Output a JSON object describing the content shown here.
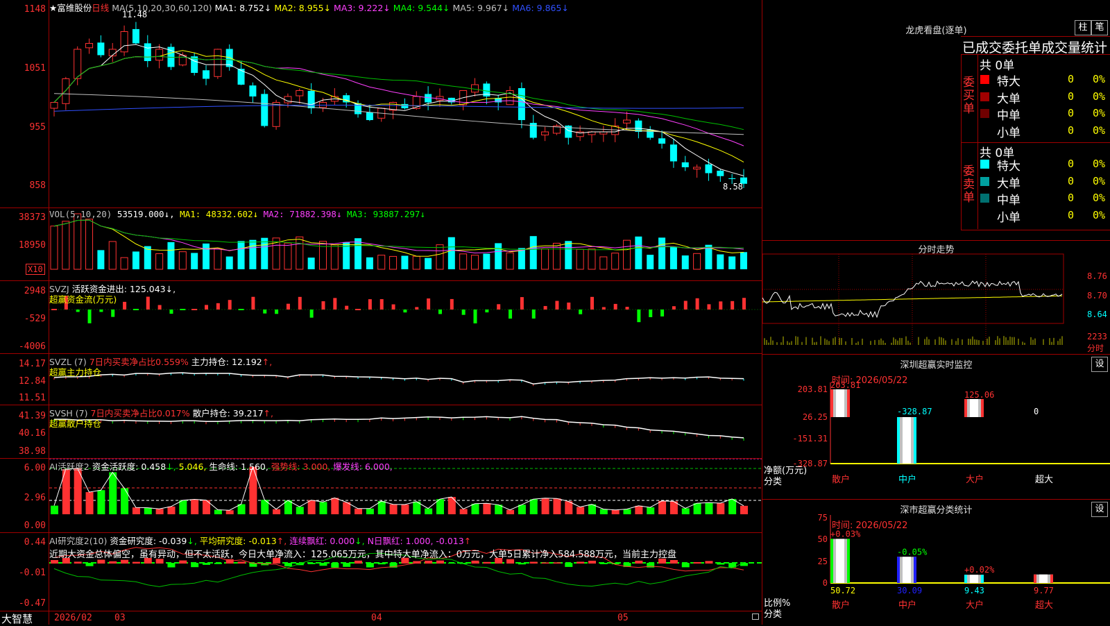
{
  "kline": {
    "stock": "★富维股份",
    "period": "日线",
    "ma_label": "MA(5,10,20,30,60,120)",
    "ma": [
      {
        "label": "MA1:",
        "value": "8.752",
        "arrow": "↓",
        "color": "#ffffff"
      },
      {
        "label": "MA2:",
        "value": "8.955",
        "arrow": "↓",
        "color": "#ffff00"
      },
      {
        "label": "MA3:",
        "value": "9.222",
        "arrow": "↓",
        "color": "#ff40ff"
      },
      {
        "label": "MA4:",
        "value": "9.544",
        "arrow": "↓",
        "color": "#00ff00"
      },
      {
        "label": "MA5:",
        "value": "9.967",
        "arrow": "↓",
        "color": "#c0c0c0"
      },
      {
        "label": "MA6:",
        "value": "9.865",
        "arrow": "↓",
        "color": "#3050ff"
      }
    ],
    "y_labels": [
      "1148",
      "1051",
      "955",
      "858"
    ],
    "high_mark": "11.48",
    "low_mark": "8.58"
  },
  "vol": {
    "title": "VOL(5,10,20)",
    "value": "53519.000",
    "ma": [
      {
        "label": "MA1:",
        "value": "48332.602",
        "arrow": "↓",
        "color": "#ffff00"
      },
      {
        "label": "MA2:",
        "value": "71882.398",
        "arrow": "↓",
        "color": "#ff40ff"
      },
      {
        "label": "MA3:",
        "value": "93887.297",
        "arrow": "↓",
        "color": "#00ff00"
      }
    ],
    "y_labels": [
      "38373",
      "18950"
    ],
    "unit": "X10"
  },
  "svzj": {
    "title": "SVZJ",
    "label": "活跃资金进出:",
    "value": "125.043",
    "arrow": "↓,",
    "sub": "超赢资金流(万元)",
    "y_labels": [
      "2948",
      "-529",
      "-4006"
    ]
  },
  "svzl": {
    "title": "SVZL (7)",
    "text1": "7日内买卖净占比0.559%",
    "text2": "主力持仓:",
    "value": "12.192",
    "arrow": "↑,",
    "sub": "超赢主力持仓",
    "y_labels": [
      "14.17",
      "12.84",
      "11.51"
    ]
  },
  "svsh": {
    "title": "SVSH (7)",
    "text1": "7日内买卖净占比0.017%",
    "text2": "散户持仓:",
    "value": "39.217",
    "arrow": "↑,",
    "sub": "超赢散户持仓",
    "y_labels": [
      "41.39",
      "40.16",
      "38.98"
    ]
  },
  "ai1": {
    "title": "AI活跃度2",
    "label": "资金活跃度:",
    "value1": "0.458",
    "value2": "5.046",
    "life_label": "生命线:",
    "life_value": "1.560",
    "strong": "强势线: 3.000,",
    "burst": "爆发线: 6.000,",
    "y_labels": [
      "6.00",
      "2.96",
      "0.00"
    ]
  },
  "ai2": {
    "title": "AI研究度2(10)",
    "label": "资金研究度:",
    "value": "-0.039",
    "avg": "平均研究度: -0.013",
    "lianxu": "连续飘红: 0.000",
    "nday": "N日飘红: 1.000, -0.013",
    "commentary": "近期大资金总体偏空，虽有异动，但不太活跃，今日大单净流入：125.065万元，其中特大单净流入：0万元，大单5日累计净入584.588万元，当前主力控盘",
    "y_labels": [
      "0.44",
      "-0.01",
      "-0.47"
    ]
  },
  "xaxis": {
    "brand": "大智慧",
    "labels": [
      "2026/02",
      "03",
      "04",
      "05"
    ]
  },
  "dragon": {
    "title": "龙虎看盘(逐单)",
    "btn1": "柱",
    "btn2": "笔",
    "header": "已成交委托单成交量统计",
    "buy_label": "委买单",
    "sell_label": "委卖单",
    "buy_total": "共 0单",
    "sell_total": "共 0单",
    "buy_rows": [
      {
        "name": "特大",
        "count": "0",
        "pct": "0%",
        "color": "#ff0000"
      },
      {
        "name": "大单",
        "count": "0",
        "pct": "0%",
        "color": "#a00000"
      },
      {
        "name": "中单",
        "count": "0",
        "pct": "0%",
        "color": "#700000"
      },
      {
        "name": "小单",
        "count": "0",
        "pct": "0%",
        "color": ""
      }
    ],
    "sell_rows": [
      {
        "name": "特大",
        "count": "0",
        "pct": "0%",
        "color": "#00ffff"
      },
      {
        "name": "大单",
        "count": "0",
        "pct": "0%",
        "color": "#00a0a0"
      },
      {
        "name": "中单",
        "count": "0",
        "pct": "0%",
        "color": "#007070"
      },
      {
        "name": "小单",
        "count": "0",
        "pct": "0%",
        "color": ""
      }
    ]
  },
  "intraday": {
    "title": "分时走势",
    "y_labels": [
      "8.76",
      "8.70",
      "8.64"
    ],
    "vol_label": "2233",
    "vol_unit": "分时"
  },
  "sz_monitor": {
    "title": "深圳超赢实时监控",
    "btn": "设",
    "time": "时间: 2026/05/22",
    "y_labels": [
      "203.81",
      "26.25",
      "-151.31",
      "-328.87"
    ],
    "left_label1": "净额(万元)",
    "left_label2": "分类",
    "bars": [
      {
        "name": "散户",
        "value": "203.81"
      },
      {
        "name": "中户",
        "value": "-328.87"
      },
      {
        "name": "大户",
        "value": "125.06"
      },
      {
        "name": "超大",
        "value": "0"
      }
    ]
  },
  "sz_stats": {
    "title": "深市超赢分类统计",
    "btn": "设",
    "time": "时间: 2026/05/22",
    "y_labels": [
      "75",
      "50",
      "25",
      "0"
    ],
    "left_label1": "比例%",
    "left_label2": "分类",
    "bars": [
      {
        "name": "散户",
        "value": "50.72",
        "delta": "+0.03%"
      },
      {
        "name": "中户",
        "value": "30.09",
        "delta": "-0.05%"
      },
      {
        "name": "大户",
        "value": "9.43",
        "delta": "+0.02%"
      },
      {
        "name": "超大",
        "value": "9.77",
        "delta": ""
      }
    ]
  }
}
